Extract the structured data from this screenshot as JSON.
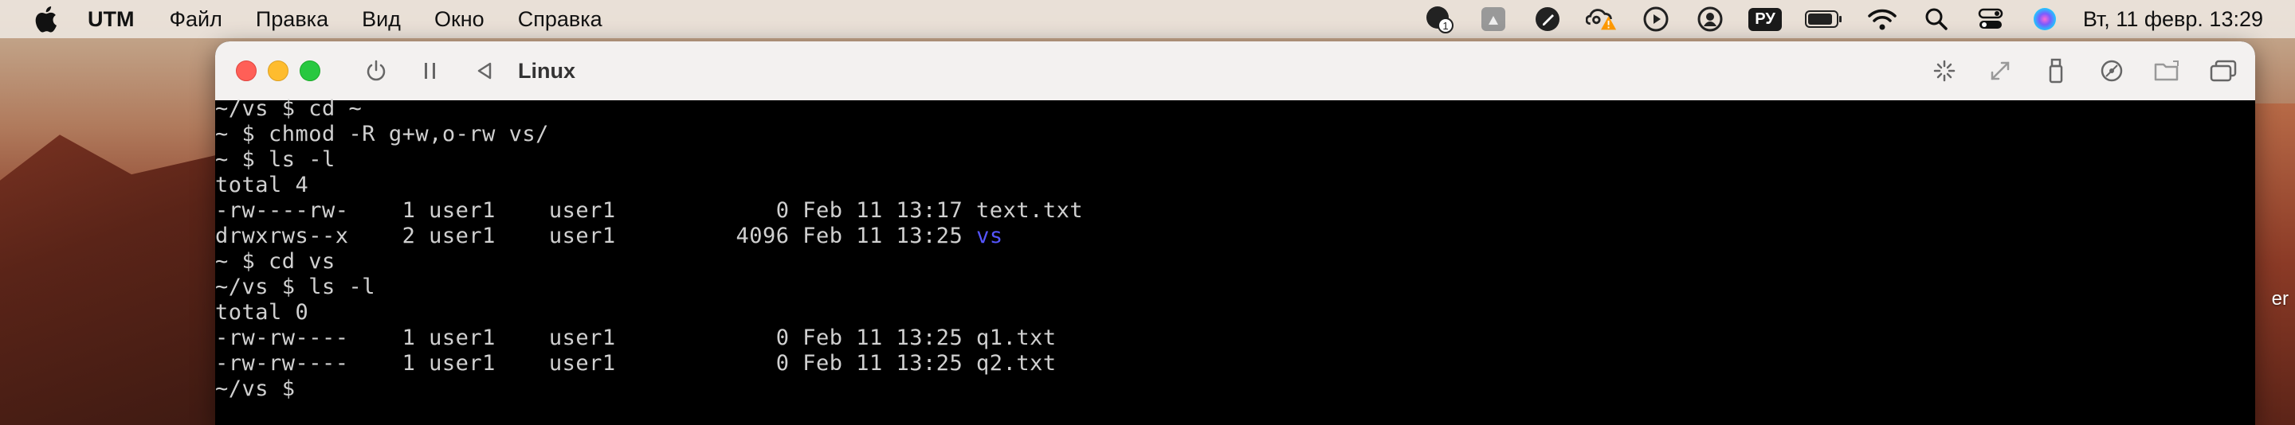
{
  "menubar": {
    "app_name": "UTM",
    "items": [
      "Файл",
      "Правка",
      "Вид",
      "Окно",
      "Справка"
    ],
    "input_source": "РУ",
    "clock": "Вт, 11 февр.  13:29"
  },
  "window": {
    "title": "Linux"
  },
  "desktop": {
    "partial_label": "er"
  },
  "terminal": {
    "lines": [
      "~/vs $ cd ~",
      "~ $ chmod -R g+w,o-rw vs/",
      "~ $ ls -l",
      "total 4",
      "-rw----rw-    1 user1    user1            0 Feb 11 13:17 text.txt",
      "drwxrws--x    2 user1    user1         4096 Feb 11 13:25 ",
      "~ $ cd vs",
      "~/vs $ ls -l",
      "total 0",
      "-rw-rw----    1 user1    user1            0 Feb 11 13:25 q1.txt",
      "-rw-rw----    1 user1    user1            0 Feb 11 13:25 q2.txt",
      "~/vs $ "
    ],
    "highlighted_dir": "vs"
  }
}
